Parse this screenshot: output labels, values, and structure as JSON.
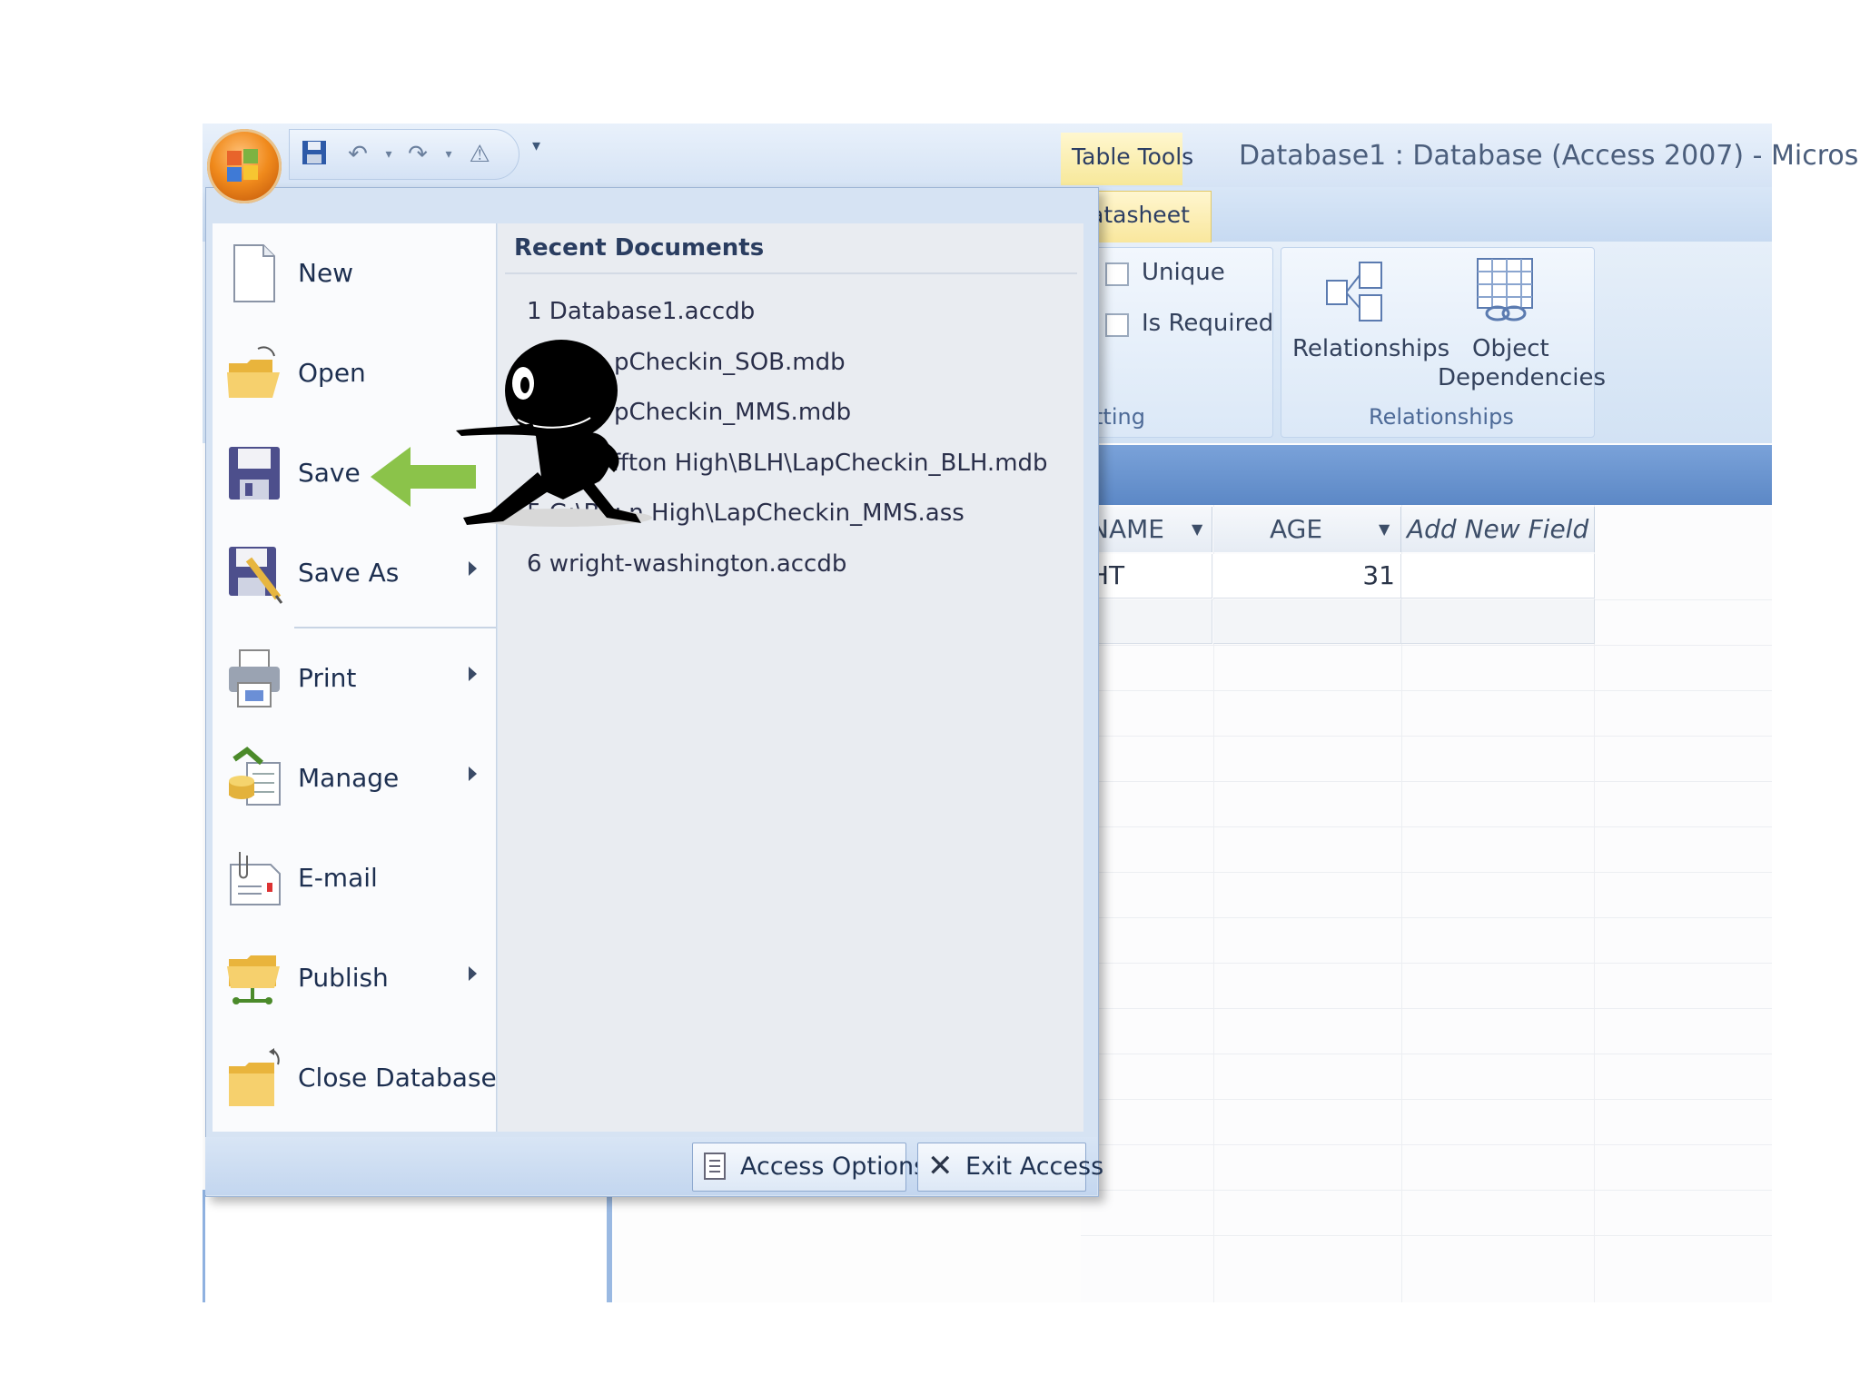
{
  "quick_access_toolbar": {
    "more_glyph": "▾"
  },
  "contextual_tab_group": "Table Tools",
  "window_title": "Database1 : Database (Access 2007) - Microso",
  "ribbon": {
    "active_tab": "atasheet",
    "data_type_group": {
      "unique_label": "Unique",
      "is_required_label": "Is Required",
      "caption_partial": "tting"
    },
    "relationships_group": {
      "relationships_label": "Relationships",
      "object_dependencies_label_1": "Object",
      "object_dependencies_label_2": "Dependencies",
      "caption": "Relationships"
    }
  },
  "datasheet": {
    "columns": [
      "NAME",
      "AGE",
      "Add New Field"
    ],
    "rows": [
      [
        "HT",
        "31",
        ""
      ]
    ]
  },
  "office_menu": {
    "items": [
      {
        "label": "New",
        "icon": "new-document-icon"
      },
      {
        "label": "Open",
        "icon": "open-folder-icon"
      },
      {
        "label": "Save",
        "icon": "floppy-disk-icon"
      },
      {
        "label": "Save As",
        "icon": "save-as-icon",
        "submenu": true
      },
      {
        "label": "Print",
        "icon": "printer-icon",
        "submenu": true
      },
      {
        "label": "Manage",
        "icon": "manage-icon",
        "submenu": true
      },
      {
        "label": "E-mail",
        "icon": "email-icon"
      },
      {
        "label": "Publish",
        "icon": "publish-icon",
        "submenu": true
      },
      {
        "label": "Close Database",
        "icon": "close-database-icon"
      }
    ],
    "recent_documents_title": "Recent Documents",
    "recent_documents": [
      "1 Database1.accdb",
      "pCheckin_SOB.mdb",
      "pCheckin_MMS.mdb",
      "ffton High\\BLH\\LapCheckin_BLH.mdb",
      "5 G:\\Blu    n High\\LapCheckin_MMS.ass",
      "6 wright-washington.accdb"
    ],
    "access_options_label": "Access Options",
    "exit_access_label": "Exit Access"
  },
  "overlay": {
    "figure": "pointing-figure",
    "arrow": "green-left-arrow"
  },
  "colors": {
    "arrow": "#8bc34a",
    "accent": "#f08a1c",
    "ribbon": "#d2e2f4"
  }
}
